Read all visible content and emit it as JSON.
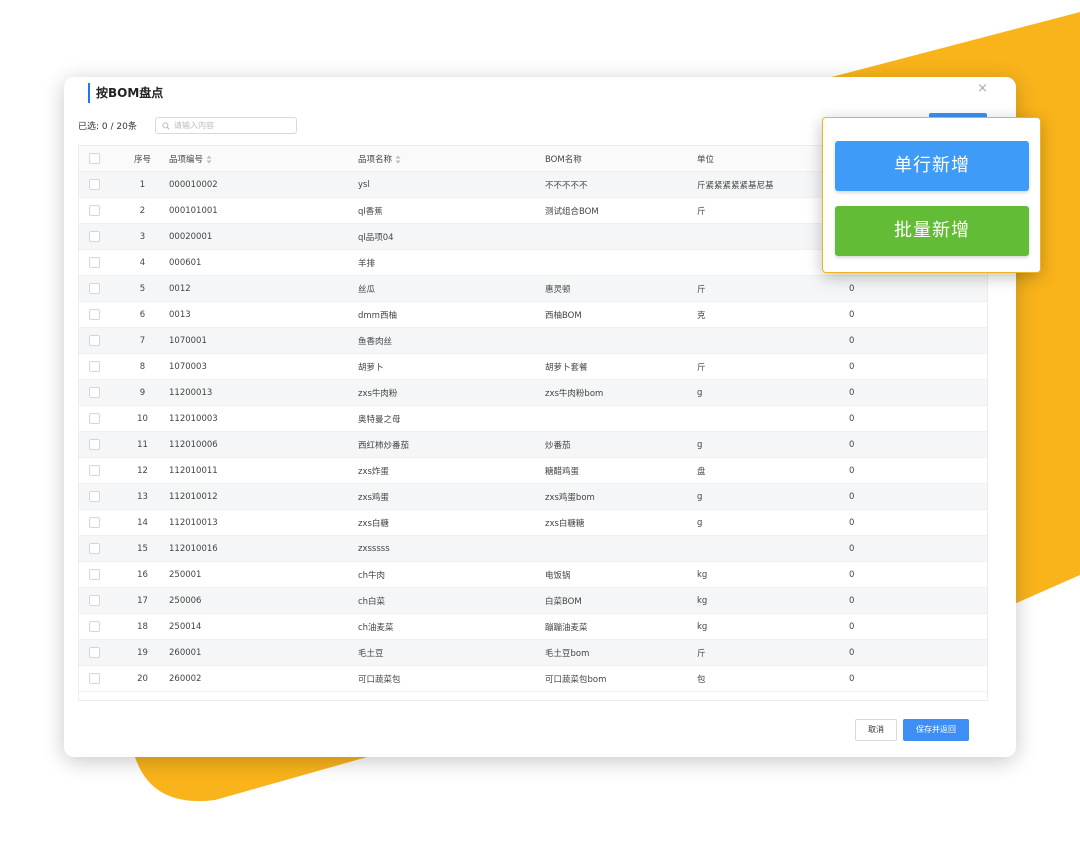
{
  "colors": {
    "accent_yellow": "#f9b41b",
    "primary_blue": "#3d8ff5",
    "green": "#62bc35"
  },
  "modal": {
    "title": "按BOM盘点",
    "close_icon": "close-icon",
    "selected_count": "已选: 0 / 20条",
    "search_placeholder": "请输入内容"
  },
  "table": {
    "headers": {
      "index": "序号",
      "code": "品项编号",
      "name": "品项名称",
      "bom": "BOM名称",
      "unit": "单位"
    },
    "rows": [
      {
        "index": "1",
        "code": "000010002",
        "name": "ysl",
        "bom": "不不不不不",
        "unit": "斤紧紧紧紧紧基尼基",
        "qty": ""
      },
      {
        "index": "2",
        "code": "000101001",
        "name": "ql香蕉",
        "bom": "测试组合BOM",
        "unit": "斤",
        "qty": ""
      },
      {
        "index": "3",
        "code": "00020001",
        "name": "ql品项04",
        "bom": "",
        "unit": "",
        "qty": ""
      },
      {
        "index": "4",
        "code": "000601",
        "name": "羊排",
        "bom": "",
        "unit": "",
        "qty": ""
      },
      {
        "index": "5",
        "code": "0012",
        "name": "丝瓜",
        "bom": "惠灵顿",
        "unit": "斤",
        "qty": "0"
      },
      {
        "index": "6",
        "code": "0013",
        "name": "dmm西柚",
        "bom": "西柚BOM",
        "unit": "克",
        "qty": "0"
      },
      {
        "index": "7",
        "code": "1070001",
        "name": "鱼香肉丝",
        "bom": "",
        "unit": "",
        "qty": "0"
      },
      {
        "index": "8",
        "code": "1070003",
        "name": "胡萝卜",
        "bom": "胡萝卜套餐",
        "unit": "斤",
        "qty": "0"
      },
      {
        "index": "9",
        "code": "11200013",
        "name": "zxs牛肉粉",
        "bom": "zxs牛肉粉bom",
        "unit": "g",
        "qty": "0"
      },
      {
        "index": "10",
        "code": "112010003",
        "name": "奥特曼之母",
        "bom": "",
        "unit": "",
        "qty": "0"
      },
      {
        "index": "11",
        "code": "112010006",
        "name": "西红柿炒番茄",
        "bom": "炒番茄",
        "unit": "g",
        "qty": "0"
      },
      {
        "index": "12",
        "code": "112010011",
        "name": "zxs炸蛋",
        "bom": "糖醋鸡蛋",
        "unit": "盘",
        "qty": "0"
      },
      {
        "index": "13",
        "code": "112010012",
        "name": "zxs鸡蛋",
        "bom": "zxs鸡蛋bom",
        "unit": "g",
        "qty": "0"
      },
      {
        "index": "14",
        "code": "112010013",
        "name": "zxs白糖",
        "bom": "zxs白糖糖",
        "unit": "g",
        "qty": "0"
      },
      {
        "index": "15",
        "code": "112010016",
        "name": "zxsssss",
        "bom": "",
        "unit": "",
        "qty": "0"
      },
      {
        "index": "16",
        "code": "250001",
        "name": "ch牛肉",
        "bom": "电饭锅",
        "unit": "kg",
        "qty": "0"
      },
      {
        "index": "17",
        "code": "250006",
        "name": "ch白菜",
        "bom": "白菜BOM",
        "unit": "kg",
        "qty": "0"
      },
      {
        "index": "18",
        "code": "250014",
        "name": "ch油麦菜",
        "bom": "蹦蹦油麦菜",
        "unit": "kg",
        "qty": "0"
      },
      {
        "index": "19",
        "code": "260001",
        "name": "毛土豆",
        "bom": "毛土豆bom",
        "unit": "斤",
        "qty": "0"
      },
      {
        "index": "20",
        "code": "260002",
        "name": "可口蔬菜包",
        "bom": "可口蔬菜包bom",
        "unit": "包",
        "qty": "0"
      }
    ]
  },
  "footer": {
    "cancel": "取消",
    "save": "保存并返回"
  },
  "popup": {
    "single_add": "单行新增",
    "batch_add": "批量新增"
  }
}
